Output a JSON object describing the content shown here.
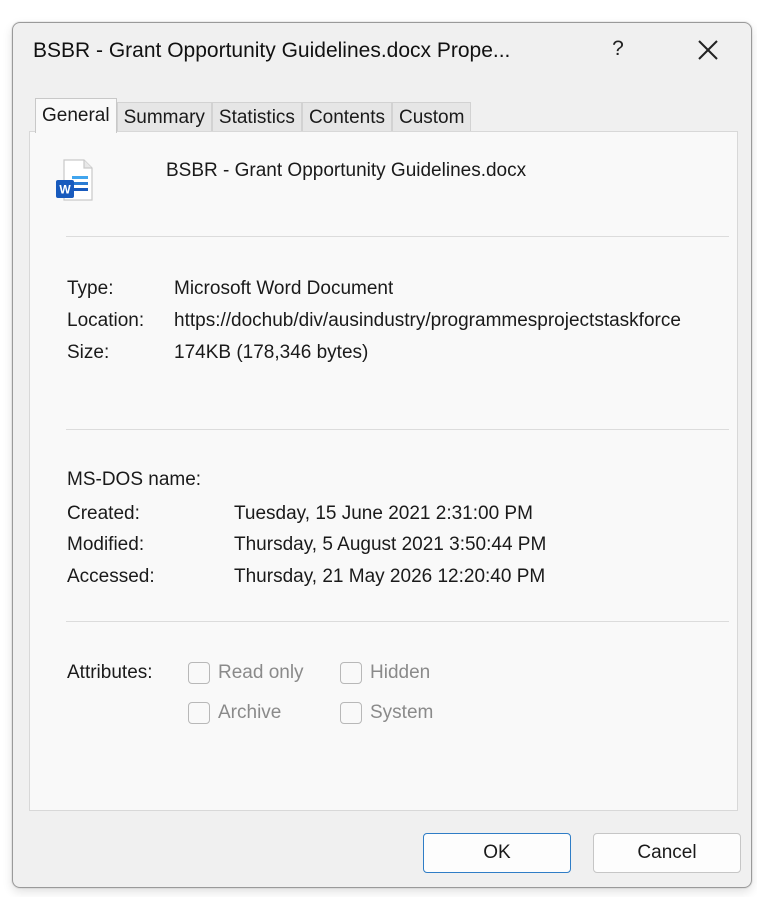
{
  "window": {
    "title": "BSBR - Grant Opportunity Guidelines.docx Prope...",
    "help_label": "?",
    "close_icon": "close-icon"
  },
  "tabs": [
    {
      "label": "General",
      "active": true
    },
    {
      "label": "Summary",
      "active": false
    },
    {
      "label": "Statistics",
      "active": false
    },
    {
      "label": "Contents",
      "active": false
    },
    {
      "label": "Custom",
      "active": false
    }
  ],
  "general": {
    "file_icon": "word-document-icon",
    "filename": "BSBR - Grant Opportunity Guidelines.docx",
    "type_label": "Type:",
    "type_value": "Microsoft Word Document",
    "location_label": "Location:",
    "location_value": "https://dochub/div/ausindustry/programmesprojectstaskforce",
    "size_label": "Size:",
    "size_value": "174KB (178,346 bytes)",
    "msdos_label": "MS-DOS name:",
    "msdos_value": "",
    "created_label": "Created:",
    "created_value": "Tuesday, 15 June 2021 2:31:00 PM",
    "modified_label": "Modified:",
    "modified_value": "Thursday, 5 August 2021 3:50:44 PM",
    "accessed_label": "Accessed:",
    "accessed_value": "Thursday, 21 May 2026 12:20:40 PM",
    "attributes_label": "Attributes:",
    "attributes": [
      {
        "label": "Read only",
        "checked": false
      },
      {
        "label": "Hidden",
        "checked": false
      },
      {
        "label": "Archive",
        "checked": false
      },
      {
        "label": "System",
        "checked": false
      }
    ]
  },
  "buttons": {
    "ok_label": "OK",
    "cancel_label": "Cancel"
  },
  "colors": {
    "accent": "#2f7dc6",
    "word_blue": "#185abd"
  }
}
